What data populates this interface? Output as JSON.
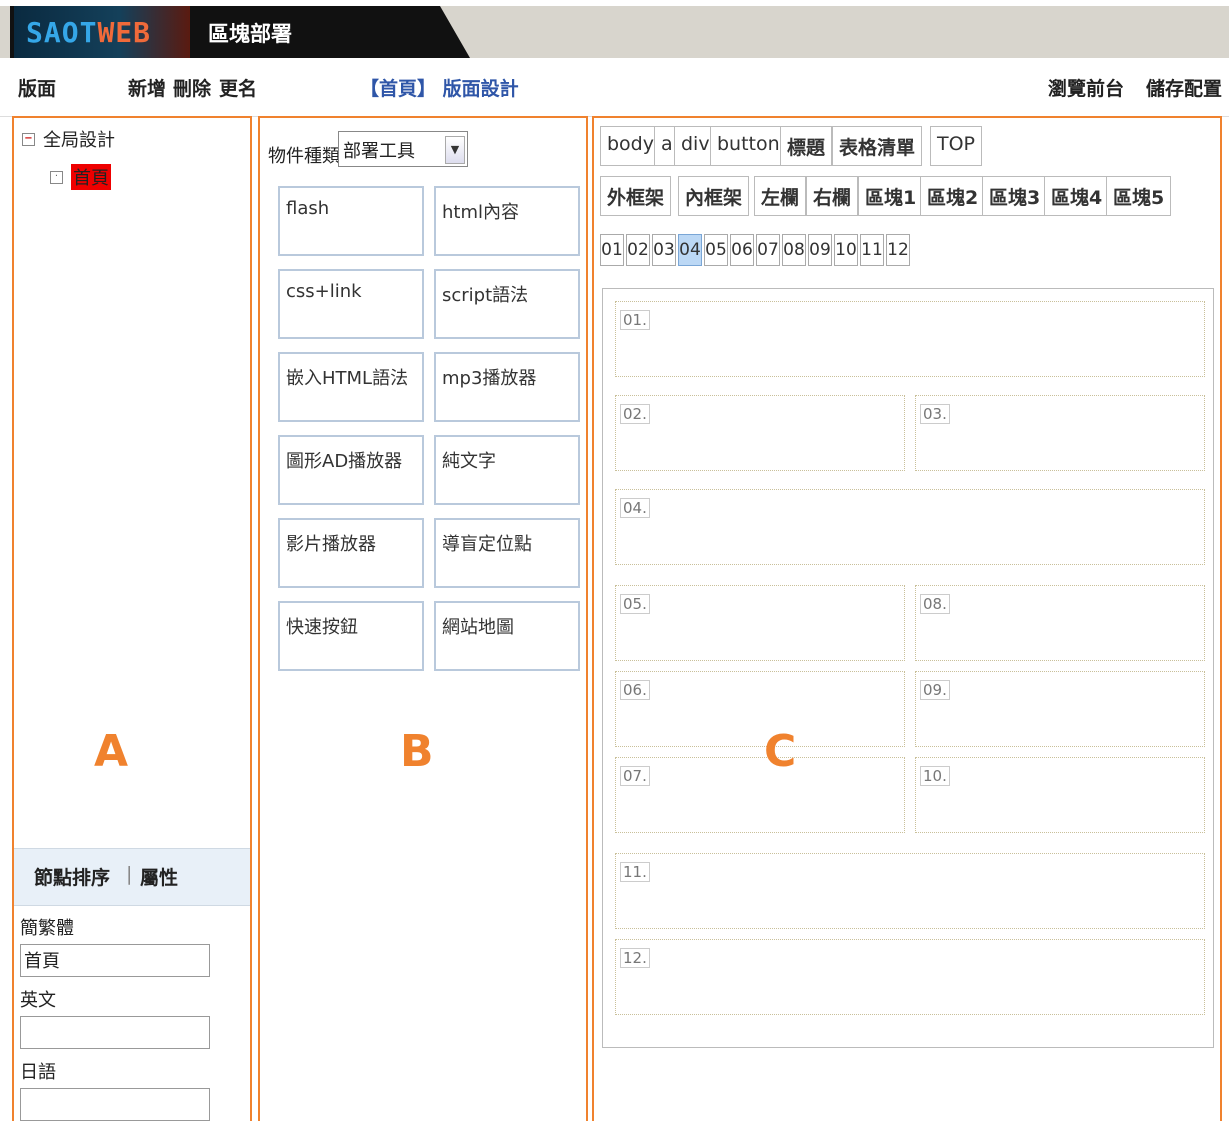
{
  "app": {
    "logo_text_a": "SAOT",
    "logo_text_b": "WEB",
    "title": "區塊部署"
  },
  "header": {
    "pages_label": "版面",
    "add": "新增",
    "delete": "刪除",
    "rename": "更名",
    "breadcrumb": "【首頁】 版面設計",
    "preview": "瀏覽前台",
    "save": "儲存配置"
  },
  "panelA": {
    "marker": "A",
    "tree": [
      {
        "label": "全局設計",
        "expanded": true
      },
      {
        "label": "首頁",
        "selected": true
      }
    ],
    "tabs": {
      "sort": "節點排序",
      "sep": "|",
      "props": "屬性"
    },
    "fields": [
      {
        "label": "簡繁體",
        "value": "首頁"
      },
      {
        "label": "英文",
        "value": ""
      },
      {
        "label": "日語",
        "value": ""
      }
    ]
  },
  "panelB": {
    "marker": "B",
    "type_label": "物件種類",
    "type_value": "部署工具",
    "tools": [
      "flash",
      "html內容",
      "css+link",
      "script語法",
      "嵌入HTML語法",
      "mp3播放器",
      "圖形AD播放器",
      "純文字",
      "影片播放器",
      "導盲定位點",
      "快速按鈕",
      "網站地圖"
    ]
  },
  "panelC": {
    "marker": "C",
    "row1": [
      "body",
      "a",
      "div",
      "button",
      "標題",
      "表格清單",
      "TOP"
    ],
    "row2": [
      "外框架",
      "內框架",
      "左欄",
      "右欄",
      "區塊1",
      "區塊2",
      "區塊3",
      "區塊4",
      "區塊5"
    ],
    "numbers": [
      "01",
      "02",
      "03",
      "04",
      "05",
      "06",
      "07",
      "08",
      "09",
      "10",
      "11",
      "12"
    ],
    "active_number": "04",
    "slots": [
      "01.",
      "02.",
      "03.",
      "04.",
      "05.",
      "08.",
      "06.",
      "09.",
      "07.",
      "10.",
      "11.",
      "12."
    ]
  },
  "colors": {
    "accent": "#f0822e",
    "link": "#2f56a8",
    "highlight": "#ee0000",
    "active": "#bcd8f5"
  }
}
